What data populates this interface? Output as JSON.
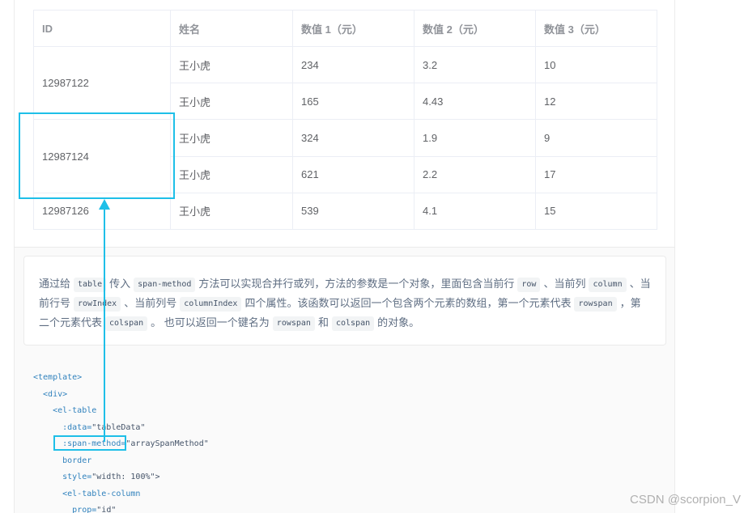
{
  "table": {
    "headers": [
      "ID",
      "姓名",
      "数值 1（元）",
      "数值 2（元）",
      "数值 3（元）"
    ],
    "groups": [
      {
        "id": "12987122",
        "rows": [
          [
            "王小虎",
            "234",
            "3.2",
            "10"
          ],
          [
            "王小虎",
            "165",
            "4.43",
            "12"
          ]
        ]
      },
      {
        "id": "12987124",
        "rows": [
          [
            "王小虎",
            "324",
            "1.9",
            "9"
          ],
          [
            "王小虎",
            "621",
            "2.2",
            "17"
          ]
        ]
      },
      {
        "id": "12987126",
        "rows": [
          [
            "王小虎",
            "539",
            "4.1",
            "15"
          ]
        ]
      }
    ]
  },
  "tip": {
    "t1": "通过给",
    "c1": "table",
    "t2": "传入",
    "c2": "span-method",
    "t3": "方法可以实现合并行或列，方法的参数是一个对象，里面包含当前行",
    "c3": "row",
    "t4": "、当前列",
    "c4": "column",
    "t5": "、当前行号",
    "c5": "rowIndex",
    "t6": "、当前列号",
    "c6": "columnIndex",
    "t7": "四个属性。该函数可以返回一个包含两个元素的数组，第一个元素代表",
    "c7": "rowspan",
    "t8": "，第二个元素代表",
    "c8": "colspan",
    "t9": "。 也可以返回一个键名为",
    "c9": "rowspan",
    "t10": "和",
    "c10": "colspan",
    "t11": "的对象。"
  },
  "code": {
    "l1": "<template>",
    "l2": "  <div>",
    "l3": "    <el-table",
    "l4a": "      :data=",
    "l4b": "\"tableData\"",
    "l5a": "      :span-method=",
    "l5b": "\"arraySpanMethod\"",
    "l6": "      border",
    "l7a": "      style=",
    "l7b": "\"width: 100%\">",
    "l8": "      <el-table-column",
    "l9a": "        prop=",
    "l9b": "\"id\""
  },
  "watermark": "CSDN @scorpion_V",
  "colors": {
    "accent": "#1ebfe8",
    "border": "#ebeef5",
    "code_keyword": "#3182bd"
  }
}
